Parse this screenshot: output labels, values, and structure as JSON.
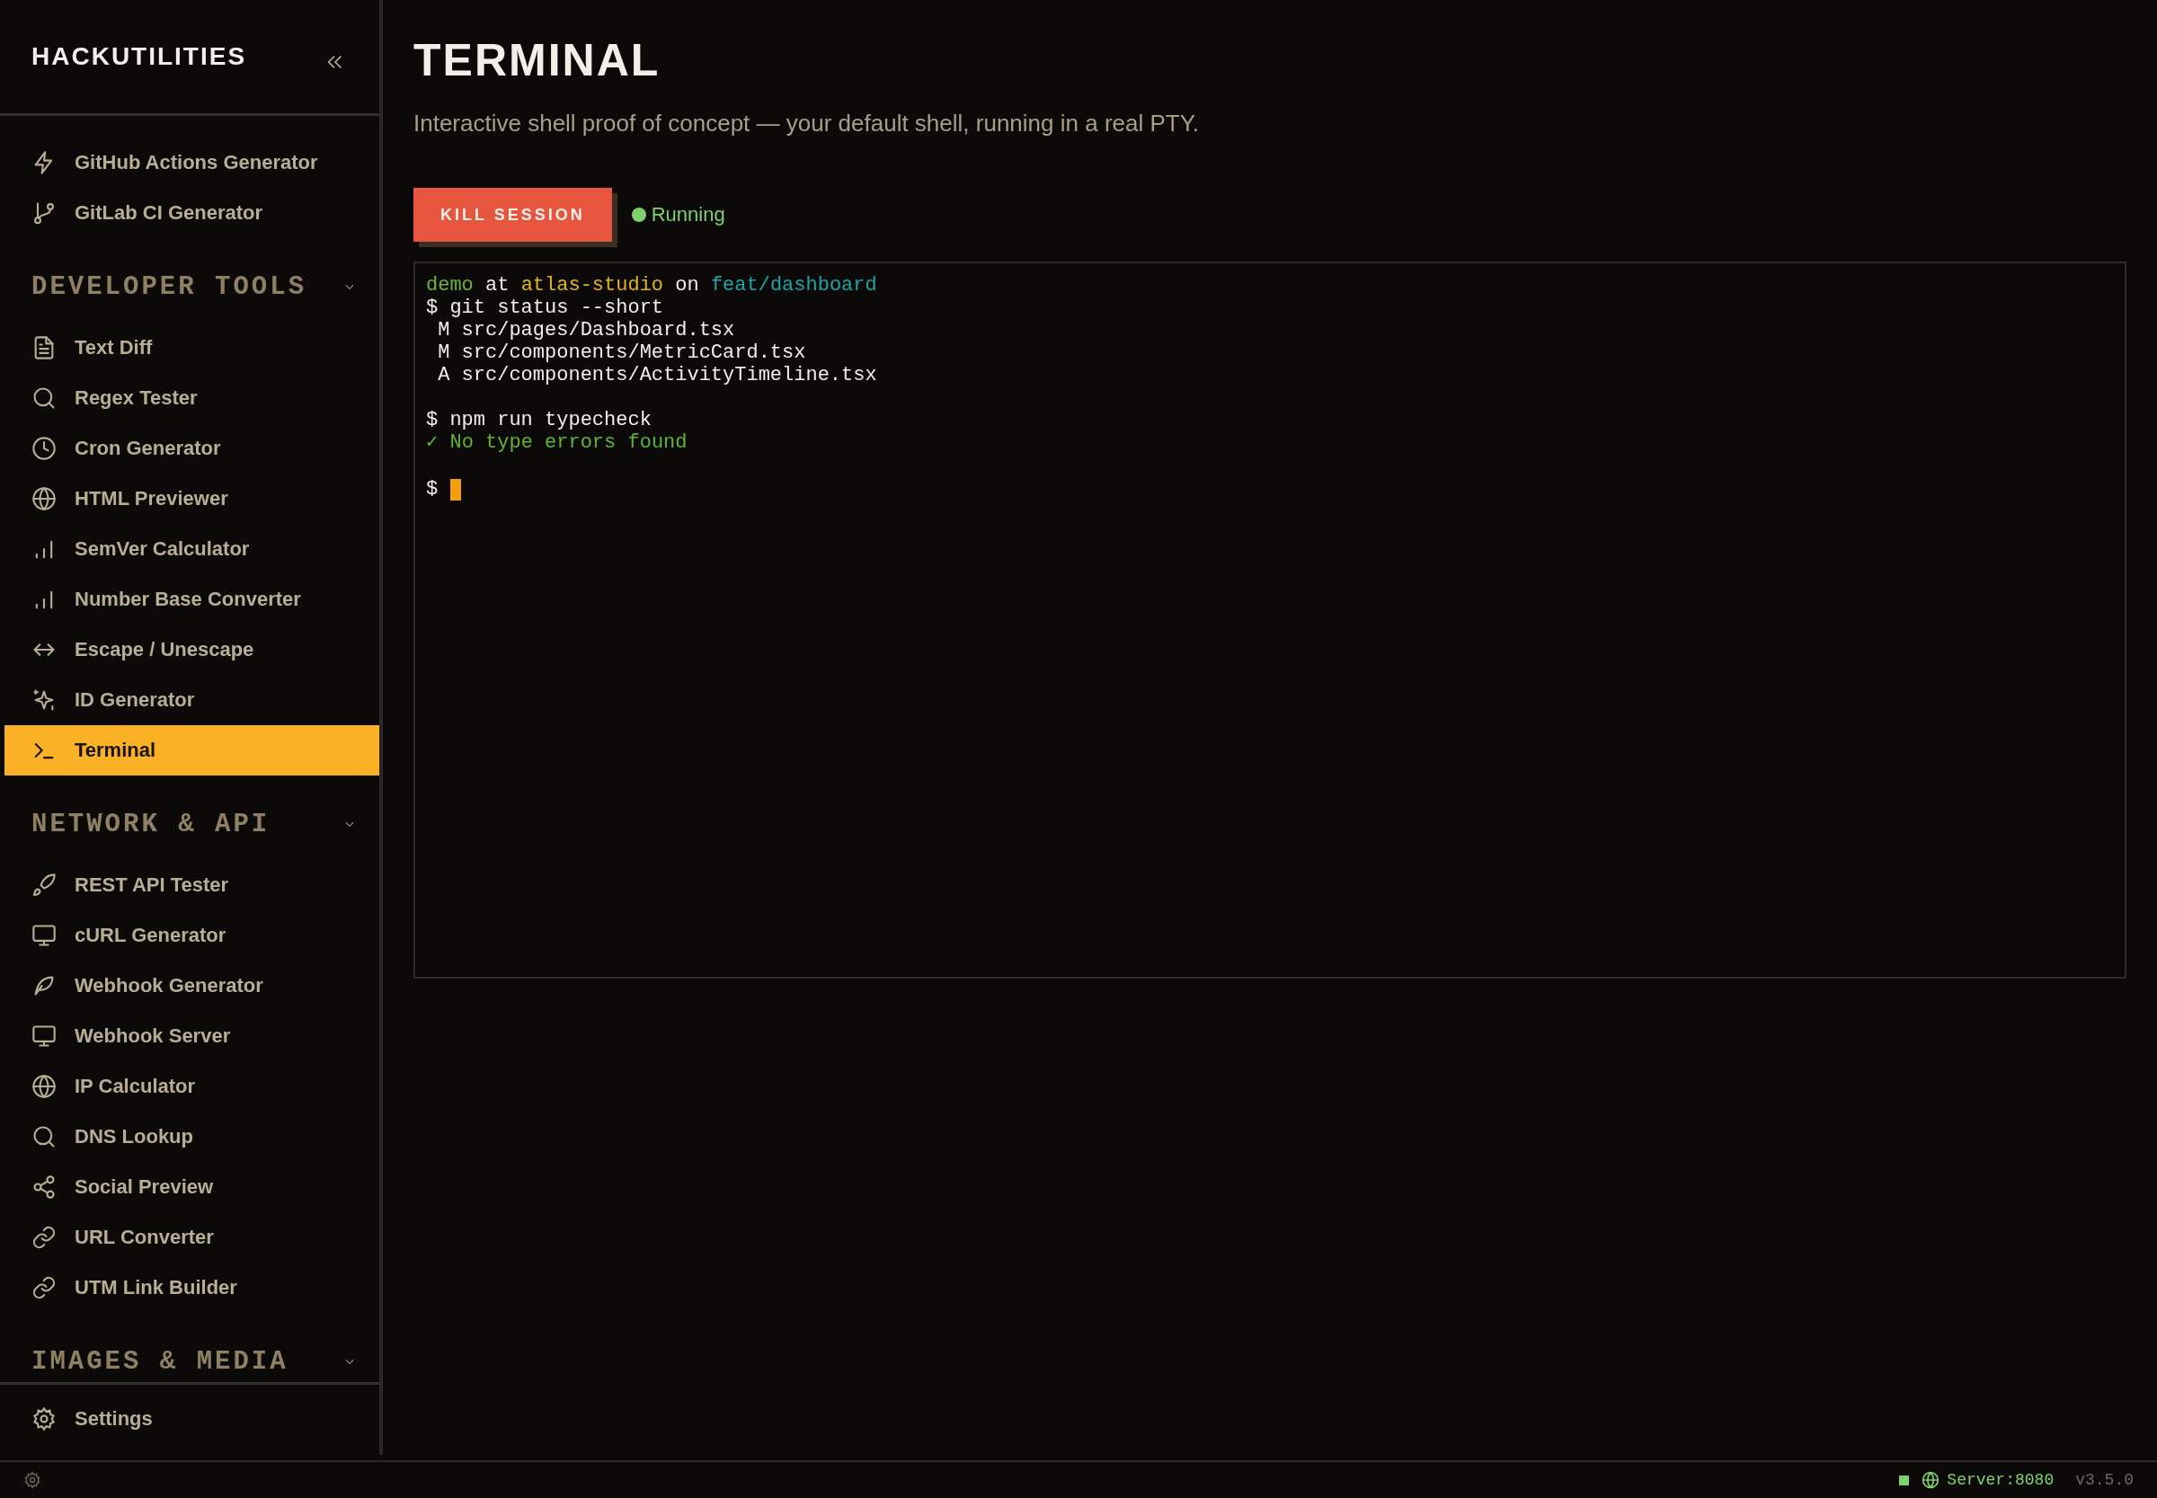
{
  "sidebar": {
    "brand": "HACKUTILITIES",
    "top_items": [
      {
        "label": "GitHub Actions Generator",
        "selected": false
      },
      {
        "label": "GitLab CI Generator",
        "selected": false
      }
    ],
    "groups": [
      {
        "title": "DEVELOPER TOOLS",
        "items": [
          {
            "label": "Text Diff",
            "selected": false
          },
          {
            "label": "Regex Tester",
            "selected": false
          },
          {
            "label": "Cron Generator",
            "selected": false
          },
          {
            "label": "HTML Previewer",
            "selected": false
          },
          {
            "label": "SemVer Calculator",
            "selected": false
          },
          {
            "label": "Number Base Converter",
            "selected": false
          },
          {
            "label": "Escape / Unescape",
            "selected": false
          },
          {
            "label": "ID Generator",
            "selected": false
          },
          {
            "label": "Terminal",
            "selected": true
          }
        ]
      },
      {
        "title": "NETWORK & API",
        "items": [
          {
            "label": "REST API Tester",
            "selected": false
          },
          {
            "label": "cURL Generator",
            "selected": false
          },
          {
            "label": "Webhook Generator",
            "selected": false
          },
          {
            "label": "Webhook Server",
            "selected": false
          },
          {
            "label": "IP Calculator",
            "selected": false
          },
          {
            "label": "DNS Lookup",
            "selected": false
          },
          {
            "label": "Social Preview",
            "selected": false
          },
          {
            "label": "URL Converter",
            "selected": false
          },
          {
            "label": "UTM Link Builder",
            "selected": false
          }
        ]
      },
      {
        "title": "IMAGES & MEDIA"
      }
    ],
    "footer_item": "Settings"
  },
  "page": {
    "title": "TERMINAL",
    "subtitle": "Interactive shell proof of concept — your default shell, running in a real PTY.",
    "kill_button": "KILL SESSION",
    "status": "Running"
  },
  "terminal": {
    "lines": [
      {
        "kind": "text",
        "segments": [
          {
            "kind": "user",
            "text": "demo"
          },
          {
            "kind": "plain",
            "text": " at "
          },
          {
            "kind": "host",
            "text": "atlas-studio"
          },
          {
            "kind": "plain",
            "text": " on "
          },
          {
            "kind": "branch",
            "text": "feat/dashboard"
          }
        ]
      },
      {
        "kind": "text",
        "segments": [
          {
            "kind": "plain",
            "text": "$ git status --short"
          }
        ]
      },
      {
        "kind": "text",
        "segments": [
          {
            "kind": "plain",
            "text": " M src/pages/Dashboard.tsx"
          }
        ]
      },
      {
        "kind": "text",
        "segments": [
          {
            "kind": "plain",
            "text": " M src/components/MetricCard.tsx"
          }
        ]
      },
      {
        "kind": "text",
        "segments": [
          {
            "kind": "plain",
            "text": " A src/components/ActivityTimeline.tsx"
          }
        ]
      },
      {
        "kind": "blank"
      },
      {
        "kind": "text",
        "segments": [
          {
            "kind": "plain",
            "text": "$ npm run typecheck"
          }
        ]
      },
      {
        "kind": "text",
        "segments": [
          {
            "kind": "success",
            "text": "✓ No type errors found"
          }
        ]
      },
      {
        "kind": "blank"
      },
      {
        "kind": "prompt",
        "text": "$"
      }
    ]
  },
  "status_bar": {
    "server": "Server:8080",
    "version": "v3.5.0"
  }
}
